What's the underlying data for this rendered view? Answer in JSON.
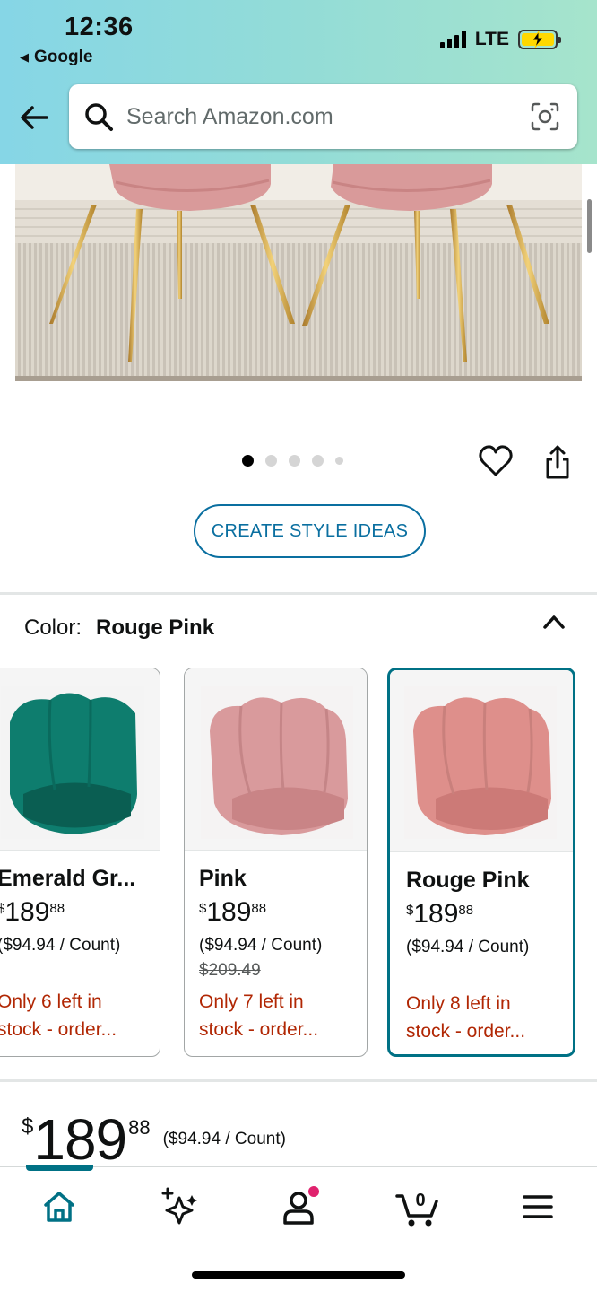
{
  "status_bar": {
    "time": "12:36",
    "back_app": "Google",
    "network": "LTE"
  },
  "search": {
    "placeholder": "Search Amazon.com"
  },
  "carousel": {
    "image_count": 5,
    "active_index": 0
  },
  "actions": {
    "style_ideas_label": "CREATE STYLE IDEAS"
  },
  "color_selector": {
    "label": "Color:",
    "selected": "Rouge Pink",
    "options": [
      {
        "name": "Emerald Gr...",
        "price_symbol": "$",
        "price_whole": "189",
        "price_cents": "88",
        "unit_price": "($94.94 / Count)",
        "list_price": "",
        "stock_line1": "Only 6 left in",
        "stock_line2": "stock - order...",
        "color": "#0e7d6e"
      },
      {
        "name": "Pink",
        "price_symbol": "$",
        "price_whole": "189",
        "price_cents": "88",
        "unit_price": "($94.94 / Count)",
        "list_price": "$209.49",
        "stock_line1": "Only 7 left in",
        "stock_line2": "stock - order...",
        "color": "#d99a9c"
      },
      {
        "name": "Rouge Pink",
        "price_symbol": "$",
        "price_whole": "189",
        "price_cents": "88",
        "unit_price": "($94.94 / Count)",
        "list_price": "",
        "stock_line1": "Only 8 left in",
        "stock_line2": "stock - order...",
        "color": "#de8f8b"
      }
    ]
  },
  "price": {
    "symbol": "$",
    "whole": "189",
    "cents": "88",
    "unit": "($94.94 / Count)"
  },
  "bottom_nav": {
    "items": [
      "home-icon",
      "ai-sparkle-icon",
      "account-icon",
      "cart-icon",
      "menu-icon"
    ],
    "cart_count": "0",
    "active": "home-icon"
  },
  "colors": {
    "link_blue": "#0a6fa0",
    "teal": "#007185",
    "stock_red": "#b12704",
    "notification_dot": "#e0226e"
  }
}
